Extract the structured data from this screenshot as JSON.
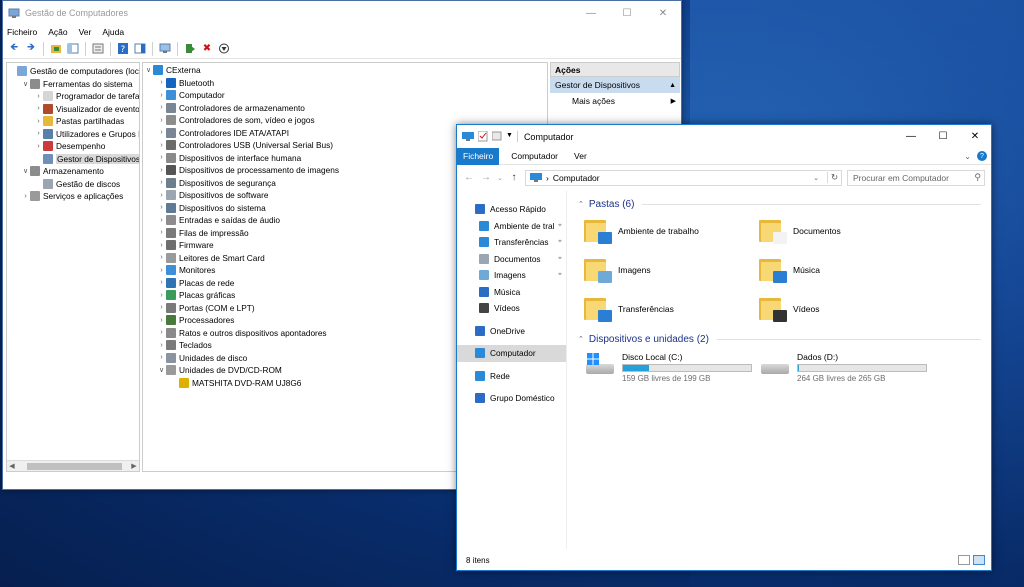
{
  "computer_management": {
    "title": "Gestão de Computadores",
    "menu": [
      "Ficheiro",
      "Ação",
      "Ver",
      "Ajuda"
    ],
    "left_tree": [
      {
        "label": "Gestão de computadores (loca",
        "indent": 0,
        "arrow": "",
        "icon": "computer-management-icon"
      },
      {
        "label": "Ferramentas do sistema",
        "indent": 1,
        "arrow": "v",
        "icon": "tools-icon"
      },
      {
        "label": "Programador de tarefas",
        "indent": 2,
        "arrow": ">",
        "icon": "clock-icon"
      },
      {
        "label": "Visualizador de eventos",
        "indent": 2,
        "arrow": ">",
        "icon": "event-viewer-icon"
      },
      {
        "label": "Pastas partilhadas",
        "indent": 2,
        "arrow": ">",
        "icon": "shared-folder-icon"
      },
      {
        "label": "Utilizadores e Grupos Lo",
        "indent": 2,
        "arrow": ">",
        "icon": "users-icon"
      },
      {
        "label": "Desempenho",
        "indent": 2,
        "arrow": ">",
        "icon": "performance-icon"
      },
      {
        "label": "Gestor de Dispositivos",
        "indent": 2,
        "arrow": "",
        "icon": "device-manager-icon",
        "selected": true
      },
      {
        "label": "Armazenamento",
        "indent": 1,
        "arrow": "v",
        "icon": "storage-icon"
      },
      {
        "label": "Gestão de discos",
        "indent": 2,
        "arrow": "",
        "icon": "disk-icon"
      },
      {
        "label": "Serviços e aplicações",
        "indent": 1,
        "arrow": ">",
        "icon": "services-icon"
      }
    ],
    "device_tree": [
      {
        "label": "CExterna",
        "indent": 0,
        "arrow": "v",
        "icon": "computer-icon"
      },
      {
        "label": "Bluetooth",
        "indent": 1,
        "arrow": ">",
        "icon": "bluetooth-icon"
      },
      {
        "label": "Computador",
        "indent": 1,
        "arrow": ">",
        "icon": "monitor-icon"
      },
      {
        "label": "Controladores de armazenamento",
        "indent": 1,
        "arrow": ">",
        "icon": "storage-controller-icon"
      },
      {
        "label": "Controladores de som, vídeo e jogos",
        "indent": 1,
        "arrow": ">",
        "icon": "sound-icon"
      },
      {
        "label": "Controladores IDE ATA/ATAPI",
        "indent": 1,
        "arrow": ">",
        "icon": "ide-icon"
      },
      {
        "label": "Controladores USB (Universal Serial Bus)",
        "indent": 1,
        "arrow": ">",
        "icon": "usb-icon"
      },
      {
        "label": "Dispositivos de interface humana",
        "indent": 1,
        "arrow": ">",
        "icon": "hid-icon"
      },
      {
        "label": "Dispositivos de processamento de imagens",
        "indent": 1,
        "arrow": ">",
        "icon": "camera-icon"
      },
      {
        "label": "Dispositivos de segurança",
        "indent": 1,
        "arrow": ">",
        "icon": "security-icon"
      },
      {
        "label": "Dispositivos de software",
        "indent": 1,
        "arrow": ">",
        "icon": "software-device-icon"
      },
      {
        "label": "Dispositivos do sistema",
        "indent": 1,
        "arrow": ">",
        "icon": "system-device-icon"
      },
      {
        "label": "Entradas e saídas de áudio",
        "indent": 1,
        "arrow": ">",
        "icon": "audio-icon"
      },
      {
        "label": "Filas de impressão",
        "indent": 1,
        "arrow": ">",
        "icon": "printer-icon"
      },
      {
        "label": "Firmware",
        "indent": 1,
        "arrow": ">",
        "icon": "firmware-icon"
      },
      {
        "label": "Leitores de Smart Card",
        "indent": 1,
        "arrow": ">",
        "icon": "smart-card-icon"
      },
      {
        "label": "Monitores",
        "indent": 1,
        "arrow": ">",
        "icon": "monitor-icon"
      },
      {
        "label": "Placas de rede",
        "indent": 1,
        "arrow": ">",
        "icon": "network-adapter-icon"
      },
      {
        "label": "Placas gráficas",
        "indent": 1,
        "arrow": ">",
        "icon": "display-adapter-icon"
      },
      {
        "label": "Portas (COM e LPT)",
        "indent": 1,
        "arrow": ">",
        "icon": "port-icon"
      },
      {
        "label": "Processadores",
        "indent": 1,
        "arrow": ">",
        "icon": "processor-icon"
      },
      {
        "label": "Ratos e outros dispositivos apontadores",
        "indent": 1,
        "arrow": ">",
        "icon": "mouse-icon"
      },
      {
        "label": "Teclados",
        "indent": 1,
        "arrow": ">",
        "icon": "keyboard-icon"
      },
      {
        "label": "Unidades de disco",
        "indent": 1,
        "arrow": ">",
        "icon": "disk-drive-icon"
      },
      {
        "label": "Unidades de DVD/CD-ROM",
        "indent": 1,
        "arrow": "v",
        "icon": "dvd-icon"
      },
      {
        "label": "MATSHITA DVD-RAM UJ8G6",
        "indent": 2,
        "arrow": "",
        "icon": "dvd-warning-icon"
      }
    ],
    "actions": {
      "header": "Ações",
      "item": "Gestor de Dispositivos",
      "sub": "Mais ações"
    }
  },
  "explorer": {
    "title": "Computador",
    "ribbon": {
      "file": "Ficheiro",
      "tabs": [
        "Computador",
        "Ver"
      ]
    },
    "address": "Computador",
    "search_placeholder": "Procurar em Computador",
    "nav": [
      {
        "label": "Acesso Rápido",
        "icon": "star-icon",
        "sub": false,
        "pin": false
      },
      {
        "label": "Ambiente de tral",
        "icon": "desktop-icon",
        "sub": true,
        "pin": true
      },
      {
        "label": "Transferências",
        "icon": "download-icon",
        "sub": true,
        "pin": true
      },
      {
        "label": "Documentos",
        "icon": "documents-icon",
        "sub": true,
        "pin": true
      },
      {
        "label": "Imagens",
        "icon": "pictures-icon",
        "sub": true,
        "pin": true
      },
      {
        "label": "Música",
        "icon": "music-icon",
        "sub": true,
        "pin": false
      },
      {
        "label": "Vídeos",
        "icon": "videos-icon",
        "sub": true,
        "pin": false
      },
      {
        "label": "OneDrive",
        "icon": "cloud-icon",
        "sub": false,
        "pin": false,
        "gap": true
      },
      {
        "label": "Computador",
        "icon": "computer-icon",
        "sub": false,
        "pin": false,
        "gap": true,
        "selected": true
      },
      {
        "label": "Rede",
        "icon": "network-icon",
        "sub": false,
        "pin": false,
        "gap": true
      },
      {
        "label": "Grupo Doméstico",
        "icon": "homegroup-icon",
        "sub": false,
        "pin": false,
        "gap": true
      }
    ],
    "folders_group": "Pastas (6)",
    "folders": [
      {
        "label": "Ambiente de trabalho",
        "badge": "#2a7fd4"
      },
      {
        "label": "Documentos",
        "badge": "#f3f3f3"
      },
      {
        "label": "Imagens",
        "badge": "#6fa9d8"
      },
      {
        "label": "Música",
        "badge": "#2a7fd4"
      },
      {
        "label": "Transferências",
        "badge": "#2a7fd4"
      },
      {
        "label": "Vídeos",
        "badge": "#333333"
      }
    ],
    "drives_group": "Dispositivos e unidades (2)",
    "drives": [
      {
        "label": "Disco Local (C:)",
        "free": "159 GB livres de 199 GB",
        "used_fraction": 0.2,
        "windows": true
      },
      {
        "label": "Dados (D:)",
        "free": "264 GB livres de 265 GB",
        "used_fraction": 0.004,
        "windows": false
      }
    ],
    "status": "8 itens"
  },
  "colors": {
    "accent": "#1979ca",
    "folder": "#f8d775",
    "selection": "#d9d9d9",
    "drive_bar": "#26a0da"
  }
}
